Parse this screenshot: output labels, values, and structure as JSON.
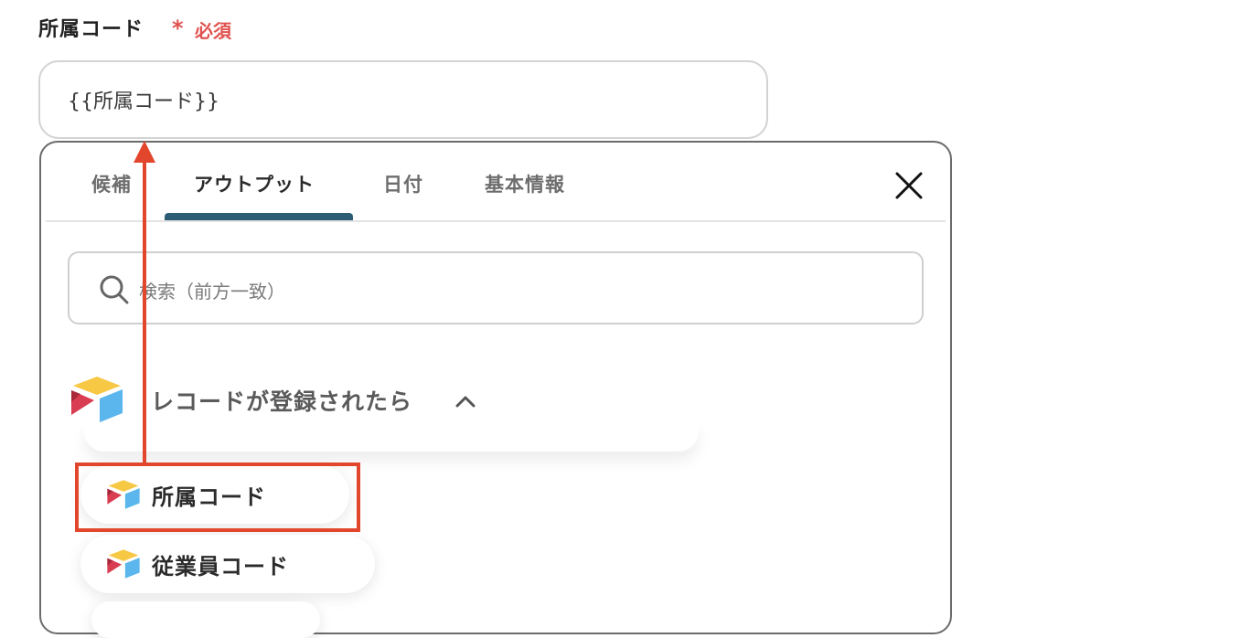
{
  "field": {
    "label": "所属コード",
    "required_mark": "*",
    "required_text": "必須",
    "value": "{{所属コード}}"
  },
  "popup": {
    "tabs": [
      {
        "label": "候補",
        "active": false
      },
      {
        "label": "アウトプット",
        "active": true
      },
      {
        "label": "日付",
        "active": false
      },
      {
        "label": "基本情報",
        "active": false
      }
    ],
    "close_icon": "close-icon",
    "search": {
      "placeholder": "検索（前方一致）"
    },
    "section": {
      "title": "レコードが登録されたら",
      "expanded": true
    },
    "items": [
      {
        "label": "所属コード",
        "highlighted": true
      },
      {
        "label": "従業員コード",
        "highlighted": false
      }
    ]
  },
  "colors": {
    "accent": "#2d5d75",
    "required": "#e0524f",
    "annotation": "#e2472d",
    "logo_yellow": "#f7c844",
    "logo_red": "#d93d52",
    "logo_blue": "#5ab6ec"
  }
}
